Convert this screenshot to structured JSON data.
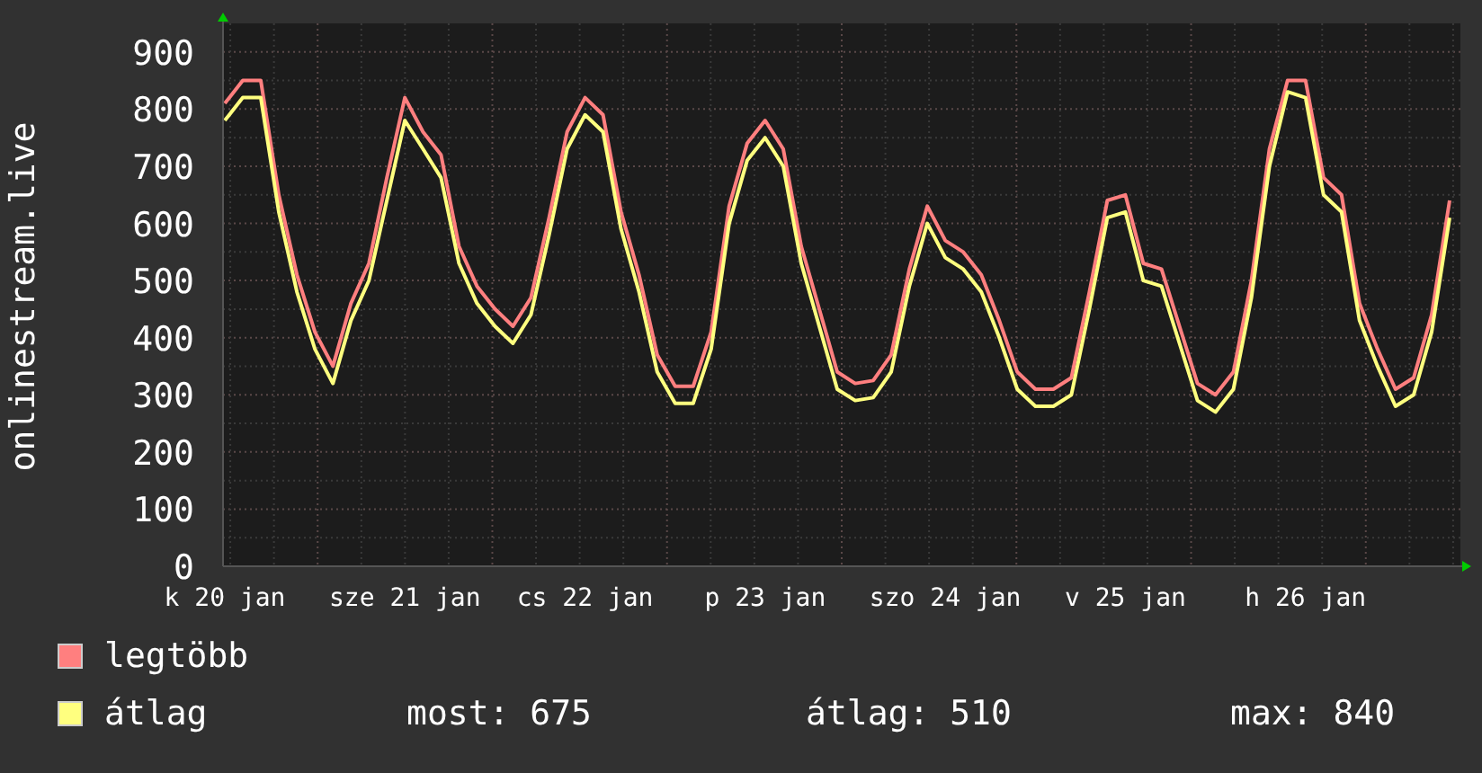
{
  "chart": {
    "chart_data": {
      "type": "line",
      "grid": true,
      "ylabel": "onlinestream.live",
      "ylim": [
        0,
        950
      ],
      "yticks": [
        0,
        100,
        200,
        300,
        400,
        500,
        600,
        700,
        800,
        900
      ],
      "categories": [
        "k 20 jan",
        null,
        null,
        null,
        null,
        null,
        null,
        null,
        null,
        null,
        "sze 21 jan",
        null,
        null,
        null,
        null,
        null,
        null,
        null,
        null,
        null,
        "cs 22 jan",
        null,
        null,
        null,
        null,
        null,
        null,
        null,
        null,
        null,
        "p 23 jan",
        null,
        null,
        null,
        null,
        null,
        null,
        null,
        null,
        null,
        "szo 24 jan",
        null,
        null,
        null,
        null,
        null,
        null,
        null,
        null,
        null,
        "v 25 jan",
        null,
        null,
        null,
        null,
        null,
        null,
        null,
        null,
        null,
        "h 26 jan",
        null,
        null,
        null,
        null,
        null,
        null,
        null,
        null
      ],
      "series": [
        {
          "name": "legtöbb",
          "color": "#ff7f7f",
          "values": [
            810,
            850,
            850,
            650,
            510,
            410,
            350,
            460,
            530,
            680,
            820,
            760,
            720,
            560,
            490,
            450,
            420,
            470,
            610,
            760,
            820,
            790,
            620,
            510,
            370,
            315,
            315,
            410,
            630,
            740,
            780,
            730,
            560,
            450,
            340,
            320,
            325,
            370,
            520,
            630,
            570,
            550,
            510,
            430,
            340,
            310,
            310,
            330,
            480,
            640,
            650,
            530,
            520,
            420,
            320,
            300,
            340,
            500,
            730,
            850,
            850,
            680,
            650,
            460,
            380,
            310,
            330,
            440,
            640
          ]
        },
        {
          "name": "átlag",
          "color": "#ffff7f",
          "values": [
            780,
            820,
            820,
            620,
            480,
            380,
            320,
            430,
            500,
            640,
            780,
            730,
            680,
            530,
            460,
            420,
            390,
            440,
            580,
            730,
            790,
            760,
            590,
            480,
            340,
            285,
            285,
            380,
            600,
            710,
            750,
            700,
            530,
            420,
            310,
            290,
            295,
            340,
            490,
            600,
            540,
            520,
            480,
            400,
            310,
            280,
            280,
            300,
            450,
            610,
            620,
            500,
            490,
            390,
            290,
            270,
            310,
            470,
            700,
            830,
            820,
            650,
            620,
            430,
            350,
            280,
            300,
            410,
            610
          ]
        }
      ]
    },
    "legend_stats": [
      "most: 675",
      "átlag: 510",
      "max: 840"
    ]
  }
}
